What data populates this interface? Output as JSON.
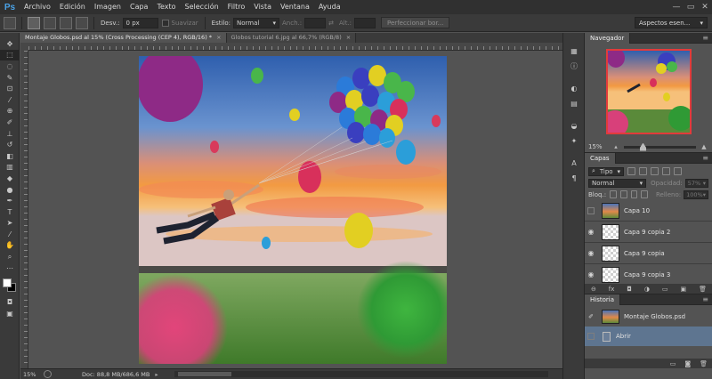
{
  "app": {
    "logo": "Ps"
  },
  "menu": [
    "Archivo",
    "Edición",
    "Imagen",
    "Capa",
    "Texto",
    "Selección",
    "Filtro",
    "Vista",
    "Ventana",
    "Ayuda"
  ],
  "window_controls": {
    "minimize": "—",
    "maximize": "▭",
    "close": "✕"
  },
  "options": {
    "feather_label": "Desv.:",
    "feather_value": "0 px",
    "antialias_label": "Suavizar",
    "style_label": "Estilo:",
    "style_value": "Normal",
    "width_label": "Anch.:",
    "height_label": "Alt.:",
    "refine_button": "Perfeccionar bor...",
    "workspace": "Aspectos esen..."
  },
  "tabs": [
    {
      "label": "Montaje Globos.psd al 15% (Cross Processing (CEP 4), RGB/16) *",
      "close": "×"
    },
    {
      "label": "Globos tutorial 6.jpg al 66,7% (RGB/8)",
      "close": "×"
    }
  ],
  "status": {
    "zoom": "15%",
    "doc_info": "Doc: 88,8 MB/686,6 MB",
    "arrow": "▸"
  },
  "navigator": {
    "title": "Navegador",
    "zoom": "15%",
    "zoom_out": "▴",
    "zoom_in": "▲"
  },
  "layers": {
    "title": "Capas",
    "kind_filter": "Tipo",
    "blend_mode": "Normal",
    "opacity_label": "Opacidad:",
    "opacity_value": "57%",
    "lock_label": "Bloq.:",
    "fill_label": "Relleno:",
    "fill_value": "100%",
    "items": [
      {
        "name": "Capa 10",
        "visible": false,
        "thumb": "photo"
      },
      {
        "name": "Capa 9 copia 2",
        "visible": true,
        "thumb": "transparent"
      },
      {
        "name": "Capa 9 copia",
        "visible": true,
        "thumb": "transparent"
      },
      {
        "name": "Capa 9 copia 3",
        "visible": true,
        "thumb": "transparent"
      }
    ],
    "footer": [
      "⊖",
      "fx",
      "◘",
      "◑",
      "▭",
      "▣",
      "🗑"
    ]
  },
  "history": {
    "title": "Historia",
    "snapshot": "Montaje Globos.psd",
    "items": [
      {
        "name": "Abrir"
      }
    ],
    "footer": [
      "▭",
      "◙",
      "🗑"
    ]
  },
  "colors": {
    "foreground": "#ffffff",
    "background": "#000000",
    "selection": "#5e7590",
    "navigator_frame": "#e23b3b"
  }
}
